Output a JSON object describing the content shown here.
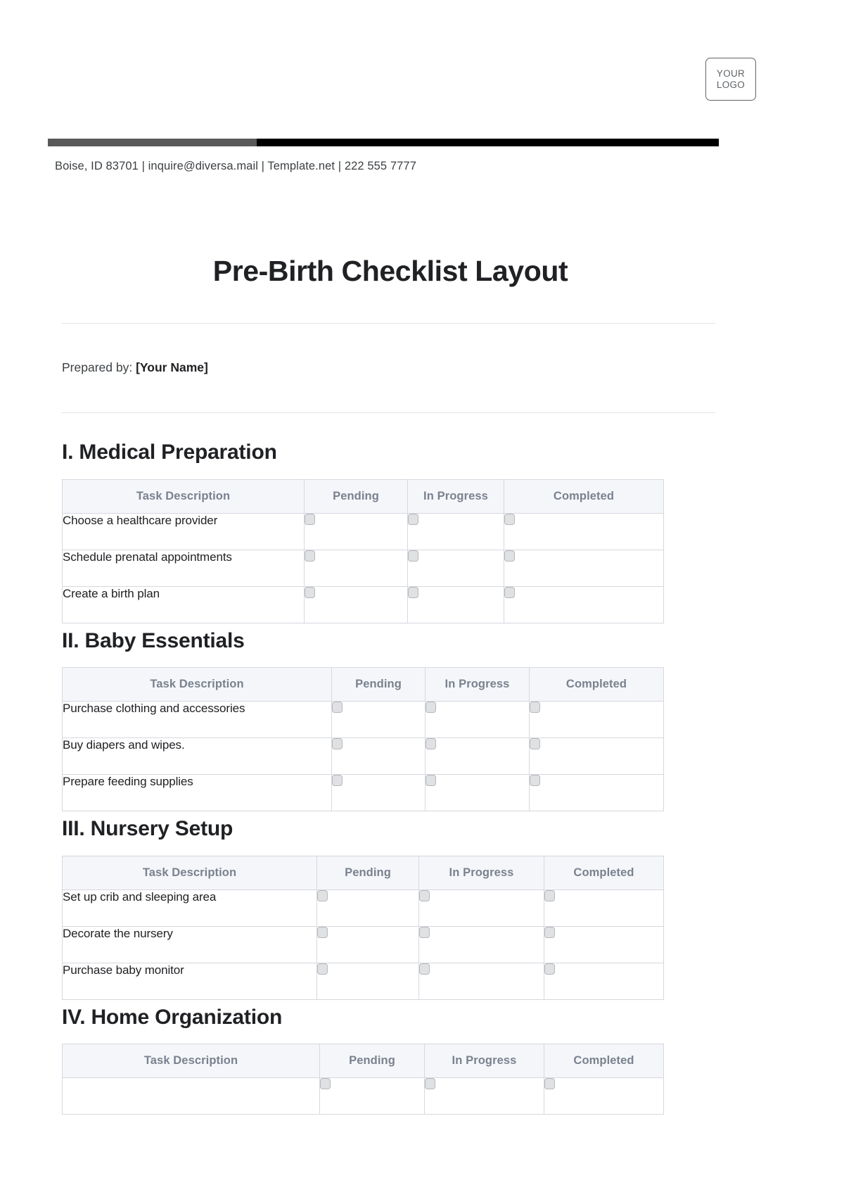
{
  "letterhead": {
    "logo": {
      "line1": "YOUR",
      "line2": "LOGO"
    },
    "contact": "Boise, ID 83701 | inquire@diversa.mail | Template.net | 222 555 7777",
    "bar_gray_color": "#595959",
    "bar_black_color": "#000000"
  },
  "document": {
    "title": "Pre-Birth Checklist Layout",
    "prepared_by_label": "Prepared by:",
    "prepared_by_value": "[Your Name]"
  },
  "table_columns": [
    "Task Description",
    "Pending",
    "In Progress",
    "Completed"
  ],
  "sections": [
    {
      "heading": "I. Medical Preparation",
      "columns": [
        "Task Description",
        "Pending",
        "In Progress",
        "Completed"
      ],
      "rows": [
        {
          "task": "Choose a healthcare provider",
          "pending": false,
          "in_progress": false,
          "completed": false
        },
        {
          "task": "Schedule prenatal appointments",
          "pending": false,
          "in_progress": false,
          "completed": false
        },
        {
          "task": "Create a birth plan",
          "pending": false,
          "in_progress": false,
          "completed": false
        }
      ]
    },
    {
      "heading": "II. Baby Essentials",
      "columns": [
        "Task Description",
        "Pending",
        "In Progress",
        "Completed"
      ],
      "rows": [
        {
          "task": "Purchase clothing and accessories",
          "pending": false,
          "in_progress": false,
          "completed": false
        },
        {
          "task": "Buy diapers and wipes.",
          "pending": false,
          "in_progress": false,
          "completed": false
        },
        {
          "task": "Prepare feeding supplies",
          "pending": false,
          "in_progress": false,
          "completed": false
        }
      ]
    },
    {
      "heading": "III. Nursery Setup",
      "columns": [
        "Task Description",
        "Pending",
        "In Progress",
        "Completed"
      ],
      "rows": [
        {
          "task": "Set up crib and sleeping area",
          "pending": false,
          "in_progress": false,
          "completed": false
        },
        {
          "task": "Decorate the nursery",
          "pending": false,
          "in_progress": false,
          "completed": false
        },
        {
          "task": "Purchase baby monitor",
          "pending": false,
          "in_progress": false,
          "completed": false
        }
      ]
    },
    {
      "heading": "IV. Home Organization",
      "columns": [
        "Task Description",
        "Pending",
        "In Progress",
        "Completed"
      ],
      "rows": [
        {
          "task": "",
          "pending": false,
          "in_progress": false,
          "completed": false
        }
      ]
    }
  ],
  "colors": {
    "header_fill": "#f4f6fa",
    "header_text": "#7a828e",
    "border": "#d6d8de",
    "checkbox_fill": "#e0e1e3",
    "checkbox_border": "#b5b8bd",
    "body_text": "#202124"
  }
}
